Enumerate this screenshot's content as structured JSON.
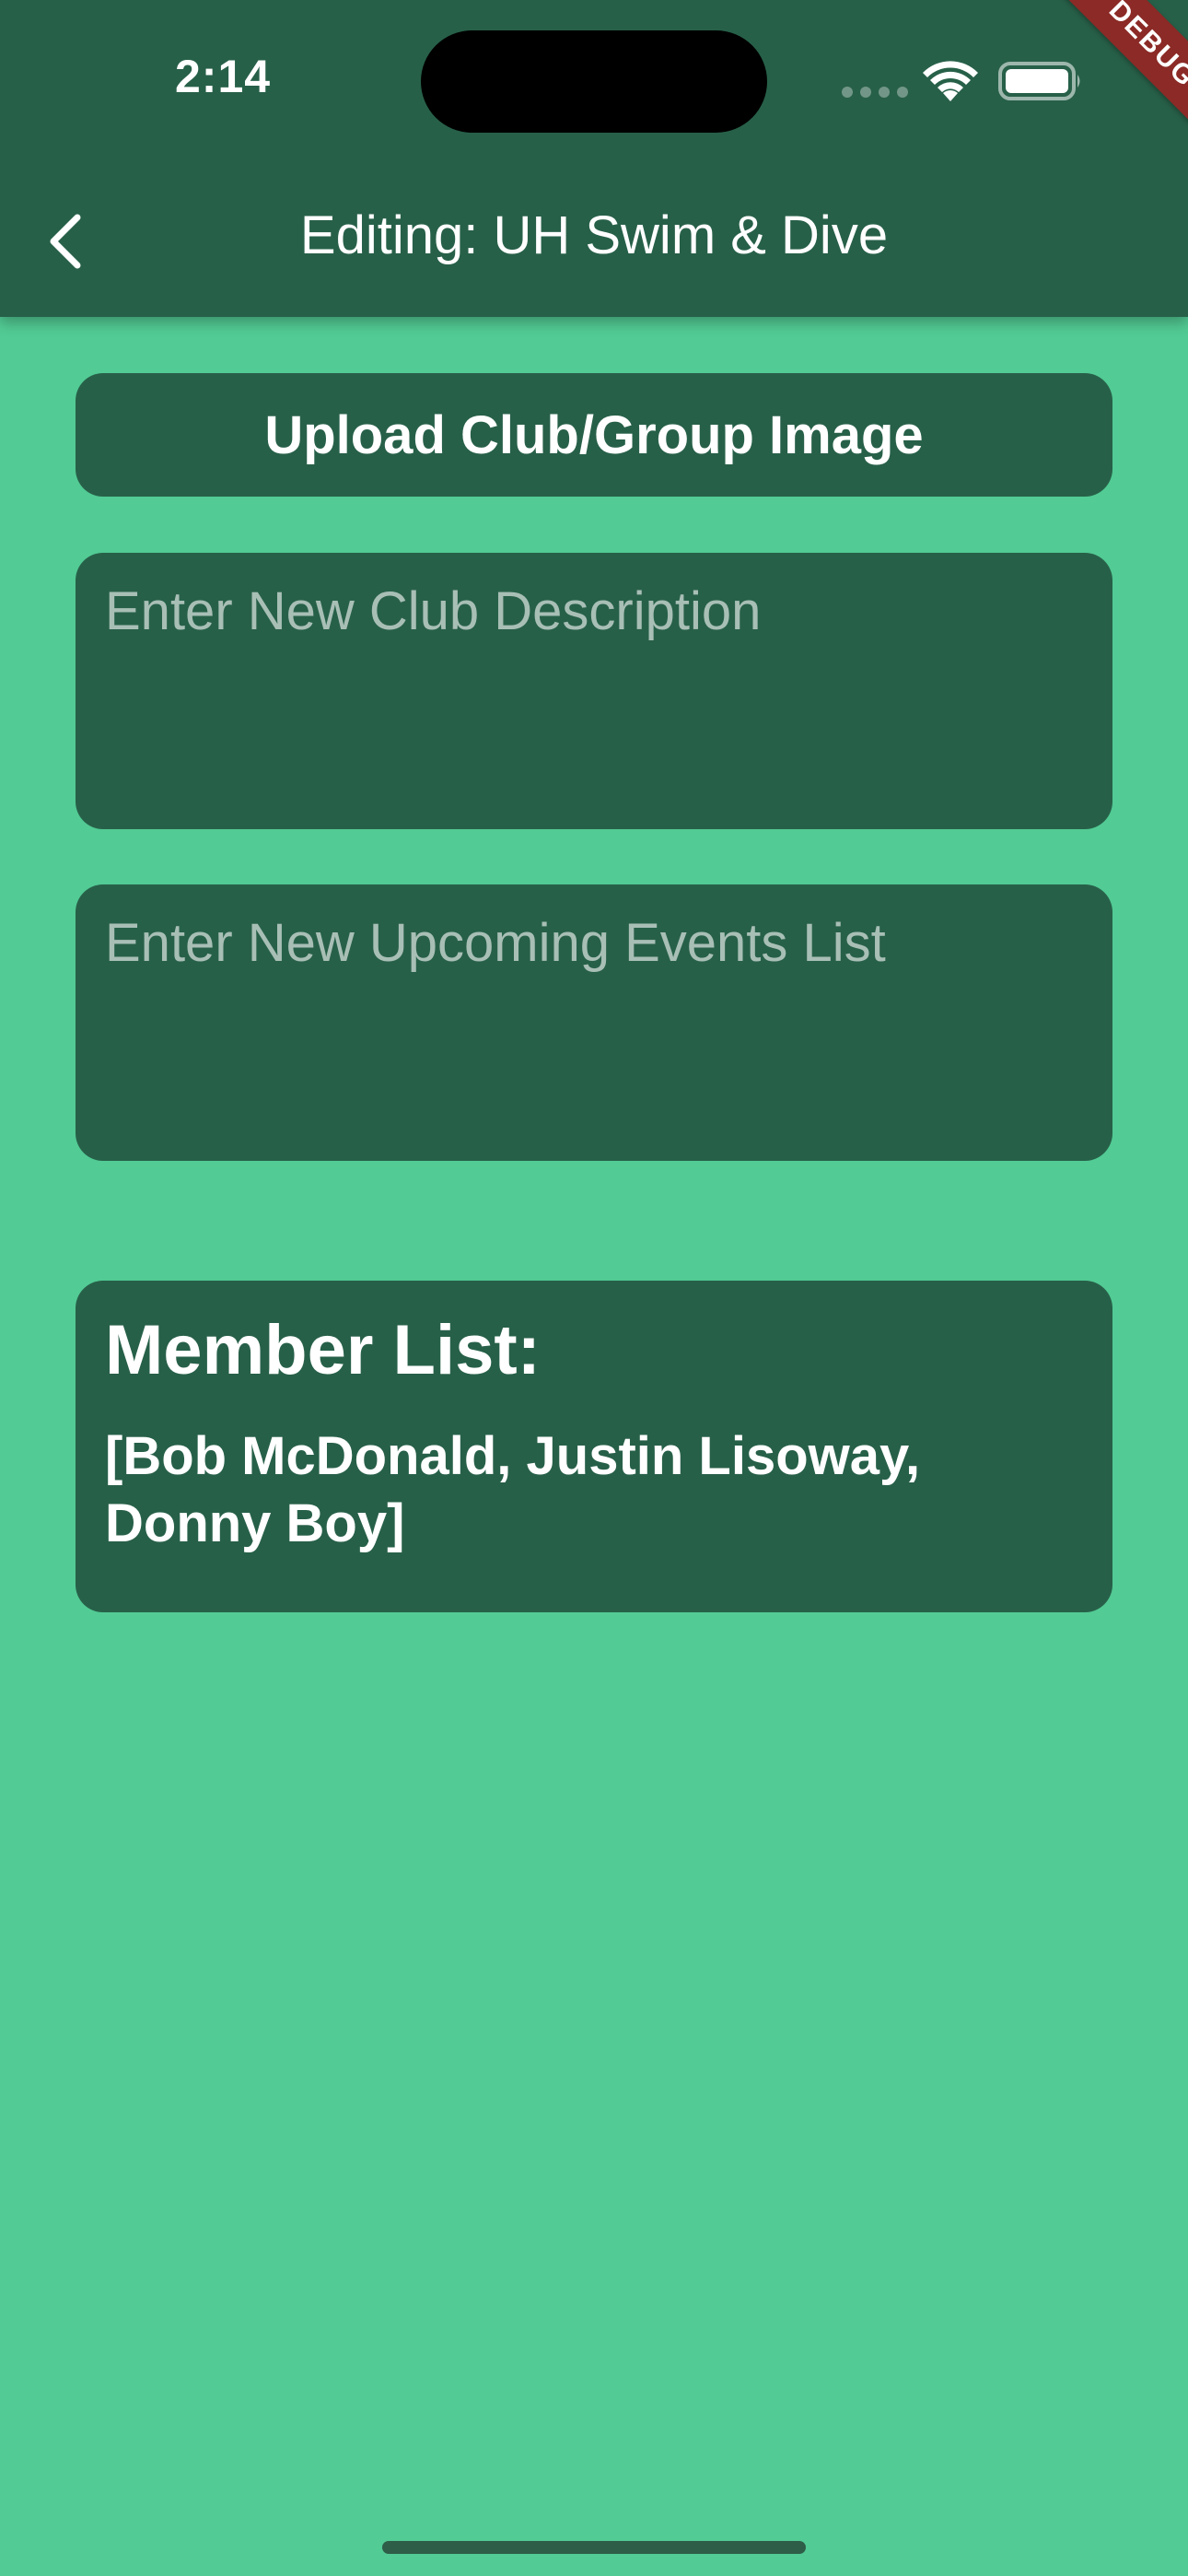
{
  "status_bar": {
    "time": "2:14",
    "debug_banner": "DEBUG"
  },
  "app_bar": {
    "title": "Editing: UH Swim & Dive"
  },
  "upload": {
    "label": "Upload Club/Group Image"
  },
  "description_field": {
    "value": "",
    "placeholder": "Enter New Club Description"
  },
  "events_field": {
    "value": "",
    "placeholder": "Enter New Upcoming Events List"
  },
  "members": {
    "title": "Member List:",
    "list_text": "[Bob McDonald, Justin Lisoway, Donny Boy]"
  },
  "colors": {
    "background": "#52cb94",
    "app_bar": "#276049",
    "card": "#276049",
    "debug_ribbon": "#8b2a26"
  },
  "icons": {
    "back": "chevron-left-icon",
    "wifi": "wifi-icon",
    "battery": "battery-icon",
    "cellular": "cellular-signal-icon"
  }
}
